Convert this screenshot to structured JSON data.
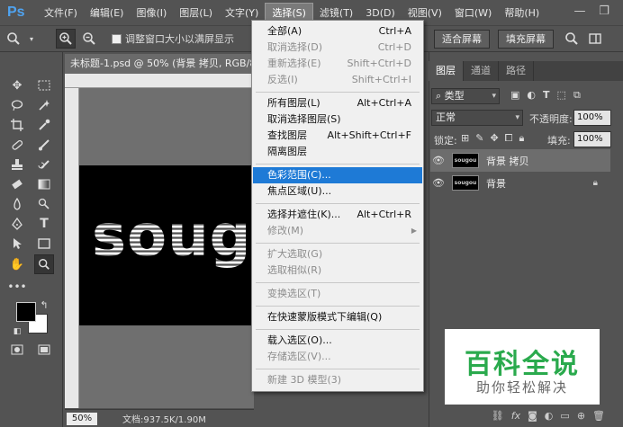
{
  "app": {
    "logo": "Ps",
    "menubar": [
      "文件(F)",
      "编辑(E)",
      "图像(I)",
      "图层(L)",
      "文字(Y)",
      "选择(S)",
      "滤镜(T)",
      "3D(D)",
      "视图(V)",
      "窗口(W)",
      "帮助(H)"
    ],
    "active_menu_index": 5,
    "window_controls": {
      "minimize": "—",
      "restore": "❐"
    }
  },
  "options": {
    "resize_checkbox_label": "调整窗口大小以满屏显示",
    "fit_screen": "适合屏幕",
    "fill_screen": "填充屏幕"
  },
  "document": {
    "tab_title": "未标题-1.psd @ 50% (背景 拷贝, RGB/8#)",
    "canvas_text": "soug",
    "zoom": "50%",
    "doc_info": "文档:937.5K/1.90M"
  },
  "layers_panel": {
    "tabs": [
      "图层",
      "通道",
      "路径"
    ],
    "filter_kind": "类型",
    "blend_mode": "正常",
    "opacity_label": "不透明度:",
    "opacity_value": "100%",
    "lock_label": "锁定:",
    "fill_label": "填充:",
    "fill_value": "100%",
    "thumb_text": "sougou",
    "layers": [
      {
        "name": "背景 拷贝",
        "selected": true
      },
      {
        "name": "背景",
        "selected": false,
        "locked": true
      }
    ]
  },
  "select_menu": {
    "items": [
      {
        "label": "全部(A)",
        "shortcut": "Ctrl+A",
        "disabled": false
      },
      {
        "label": "取消选择(D)",
        "shortcut": "Ctrl+D",
        "disabled": true
      },
      {
        "label": "重新选择(E)",
        "shortcut": "Shift+Ctrl+D",
        "disabled": true
      },
      {
        "label": "反选(I)",
        "shortcut": "Shift+Ctrl+I",
        "disabled": true
      },
      {
        "label": "所有图层(L)",
        "shortcut": "Alt+Ctrl+A",
        "disabled": false
      },
      {
        "label": "取消选择图层(S)",
        "shortcut": "",
        "disabled": false
      },
      {
        "label": "查找图层",
        "shortcut": "Alt+Shift+Ctrl+F",
        "disabled": false
      },
      {
        "label": "隔离图层",
        "shortcut": "",
        "disabled": false
      },
      {
        "label": "色彩范围(C)...",
        "shortcut": "",
        "disabled": false,
        "highlighted": true
      },
      {
        "label": "焦点区域(U)...",
        "shortcut": "",
        "disabled": false
      },
      {
        "label": "选择并遮住(K)...",
        "shortcut": "Alt+Ctrl+R",
        "disabled": false
      },
      {
        "label": "修改(M)",
        "shortcut": "",
        "disabled": true,
        "submenu": true
      },
      {
        "label": "扩大选取(G)",
        "shortcut": "",
        "disabled": true
      },
      {
        "label": "选取相似(R)",
        "shortcut": "",
        "disabled": true
      },
      {
        "label": "变换选区(T)",
        "shortcut": "",
        "disabled": true
      },
      {
        "label": "在快速蒙版模式下编辑(Q)",
        "shortcut": "",
        "disabled": false
      },
      {
        "label": "载入选区(O)...",
        "shortcut": "",
        "disabled": false
      },
      {
        "label": "存储选区(V)...",
        "shortcut": "",
        "disabled": true
      },
      {
        "label": "新建 3D 模型(3)",
        "shortcut": "",
        "disabled": true
      }
    ]
  },
  "watermark": {
    "title": "百科全说",
    "subtitle": "助你轻松解决"
  }
}
